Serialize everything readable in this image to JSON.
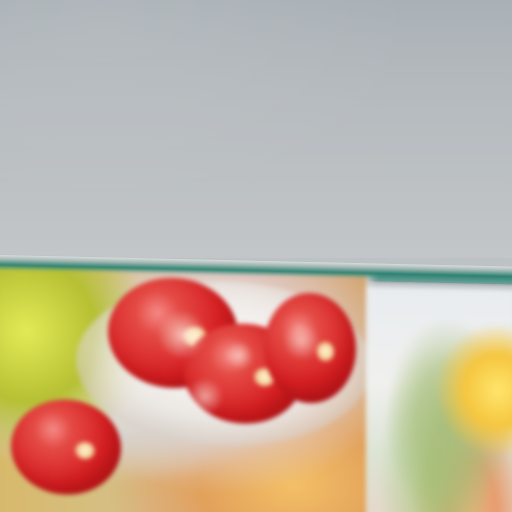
{
  "screen": {
    "top_panel": {},
    "divider": {
      "color": "#2d8372"
    },
    "photo": {
      "left_segment": "tomato-bowl-photo",
      "right_segment": "salad-plate-photo"
    }
  }
}
